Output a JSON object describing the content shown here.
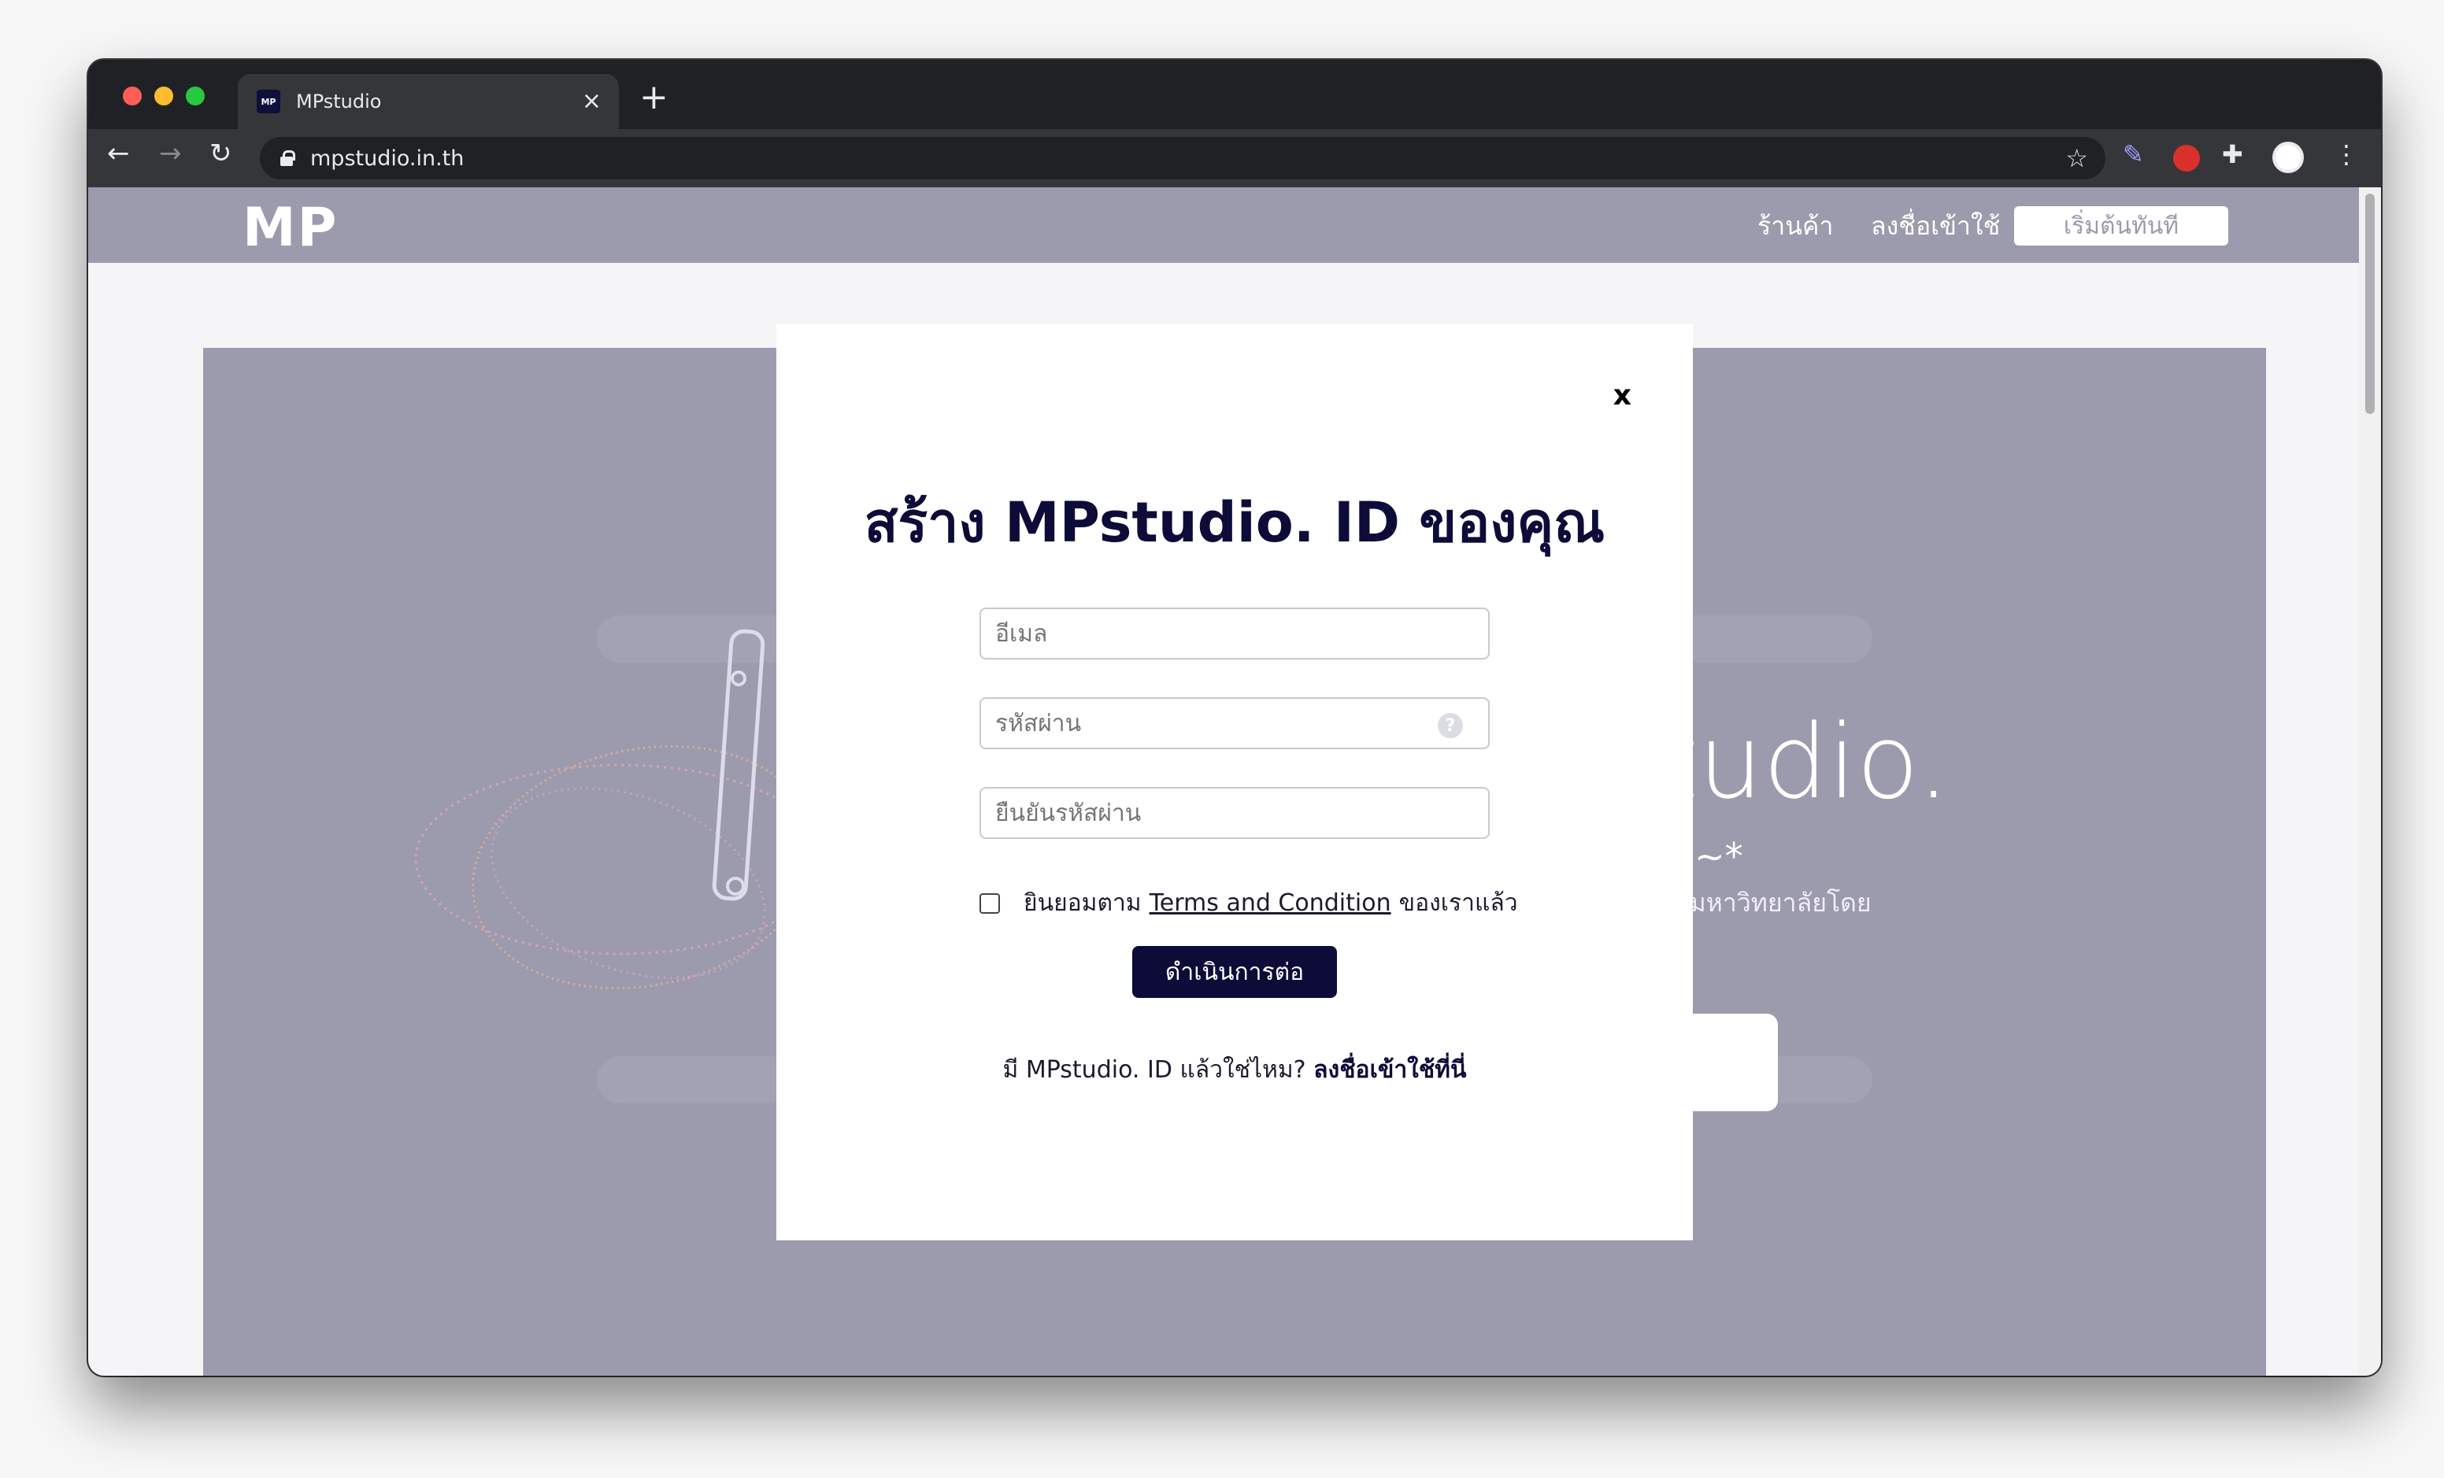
{
  "browser": {
    "tab_title": "MPstudio",
    "favicon_text": "MP",
    "url": "mpstudio.in.th",
    "close_label": "×",
    "newtab_label": "+"
  },
  "site": {
    "logo": "MP",
    "nav": {
      "shop": "ร้านค้า",
      "login": "ลงชื่อเข้าใช้",
      "start": "เริ่มต้นทันที"
    }
  },
  "hero": {
    "brand": "studio.",
    "tagline": "สวยงาม ~*",
    "subtitle": "ตรียมสอบเข้ามหาวิทยาลัยโดย"
  },
  "modal": {
    "close": "x",
    "title": "สร้าง MPstudio. ID ของคุณ",
    "email_placeholder": "อีเมล",
    "password_placeholder": "รหัสผ่าน",
    "confirm_placeholder": "ยืนยันรหัสผ่าน",
    "terms_prefix": "ยินยอมตาม",
    "terms_link": "Terms and Condition",
    "terms_suffix": "ของเราแล้ว",
    "submit": "ดำเนินการต่อ",
    "login_prompt": "มี MPstudio. ID แล้วใช่ไหม?",
    "login_link": "ลงชื่อเข้าใช้ที่นี่"
  },
  "colors": {
    "brand_dark": "#0d0b38",
    "nav_bg": "#9c9bae"
  }
}
